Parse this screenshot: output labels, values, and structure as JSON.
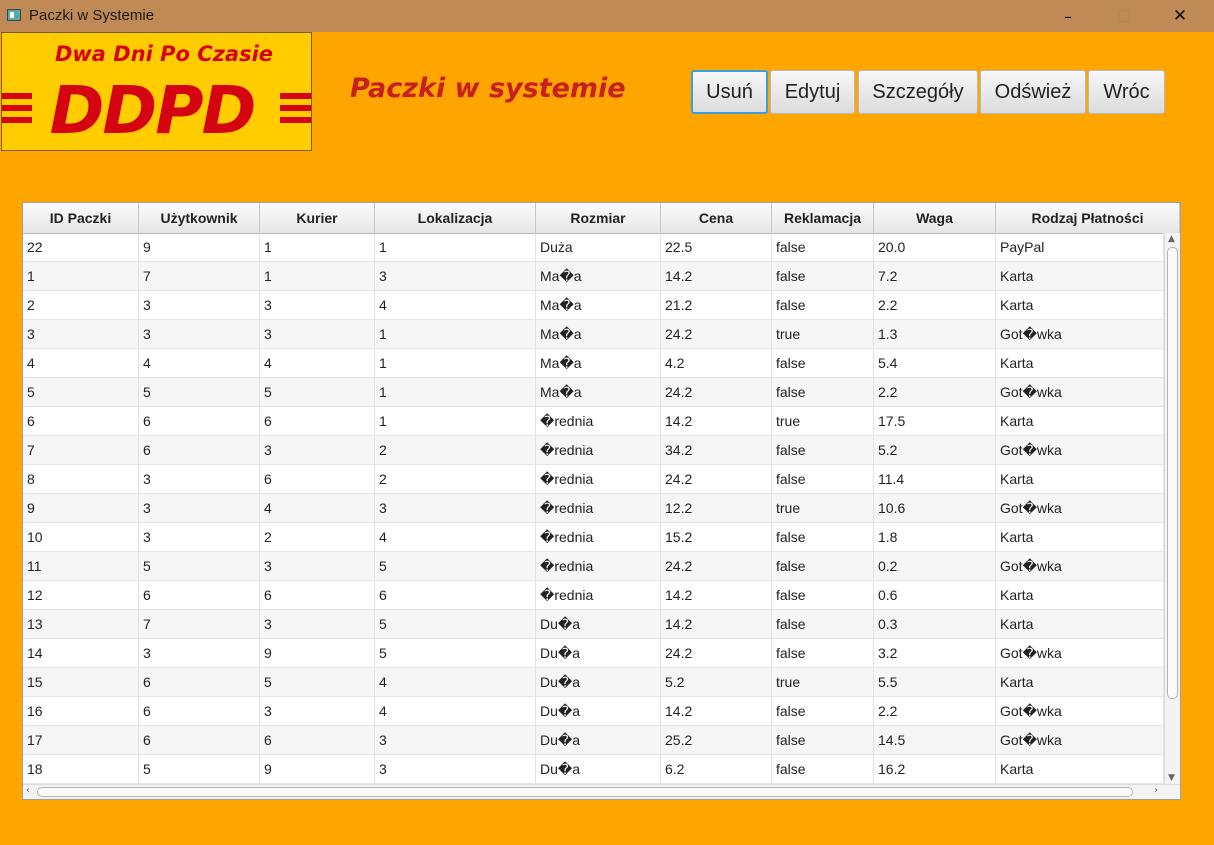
{
  "window": {
    "title": "Paczki w Systemie",
    "minimize_icon": "minimize-icon",
    "maximize_icon": "maximize-icon",
    "close_icon": "close-icon"
  },
  "logo": {
    "tagline": "Dwa Dni Po Czasie",
    "letters": "DDPD"
  },
  "header": {
    "title": "Paczki w systemie"
  },
  "toolbar": {
    "delete_label": "Usuń",
    "edit_label": "Edytuj",
    "details_label": "Szczegóły",
    "refresh_label": "Odśwież",
    "back_label": "Wróc"
  },
  "table": {
    "columns": [
      "ID Paczki",
      "Użytkownik",
      "Kurier",
      "Lokalizacja",
      "Rozmiar",
      "Cena",
      "Reklamacja",
      "Waga",
      "Rodzaj Płatności"
    ],
    "rows": [
      [
        "22",
        "9",
        "1",
        "1",
        "Duża",
        "22.5",
        "false",
        "20.0",
        "PayPal"
      ],
      [
        "1",
        "7",
        "1",
        "3",
        "Ma�a",
        "14.2",
        "false",
        "7.2",
        "Karta"
      ],
      [
        "2",
        "3",
        "3",
        "4",
        "Ma�a",
        "21.2",
        "false",
        "2.2",
        "Karta"
      ],
      [
        "3",
        "3",
        "3",
        "1",
        "Ma�a",
        "24.2",
        "true",
        "1.3",
        "Got�wka"
      ],
      [
        "4",
        "4",
        "4",
        "1",
        "Ma�a",
        "4.2",
        "false",
        "5.4",
        "Karta"
      ],
      [
        "5",
        "5",
        "5",
        "1",
        "Ma�a",
        "24.2",
        "false",
        "2.2",
        "Got�wka"
      ],
      [
        "6",
        "6",
        "6",
        "1",
        "�rednia",
        "14.2",
        "true",
        "17.5",
        "Karta"
      ],
      [
        "7",
        "6",
        "3",
        "2",
        "�rednia",
        "34.2",
        "false",
        "5.2",
        "Got�wka"
      ],
      [
        "8",
        "3",
        "6",
        "2",
        "�rednia",
        "24.2",
        "false",
        "11.4",
        "Karta"
      ],
      [
        "9",
        "3",
        "4",
        "3",
        "�rednia",
        "12.2",
        "true",
        "10.6",
        "Got�wka"
      ],
      [
        "10",
        "3",
        "2",
        "4",
        "�rednia",
        "15.2",
        "false",
        "1.8",
        "Karta"
      ],
      [
        "11",
        "5",
        "3",
        "5",
        "�rednia",
        "24.2",
        "false",
        "0.2",
        "Got�wka"
      ],
      [
        "12",
        "6",
        "6",
        "6",
        "�rednia",
        "14.2",
        "false",
        "0.6",
        "Karta"
      ],
      [
        "13",
        "7",
        "3",
        "5",
        "Du�a",
        "14.2",
        "false",
        "0.3",
        "Karta"
      ],
      [
        "14",
        "3",
        "9",
        "5",
        "Du�a",
        "24.2",
        "false",
        "3.2",
        "Got�wka"
      ],
      [
        "15",
        "6",
        "5",
        "4",
        "Du�a",
        "5.2",
        "true",
        "5.5",
        "Karta"
      ],
      [
        "16",
        "6",
        "3",
        "4",
        "Du�a",
        "14.2",
        "false",
        "2.2",
        "Got�wka"
      ],
      [
        "17",
        "6",
        "6",
        "3",
        "Du�a",
        "25.2",
        "false",
        "14.5",
        "Got�wka"
      ],
      [
        "18",
        "5",
        "9",
        "3",
        "Du�a",
        "6.2",
        "false",
        "16.2",
        "Karta"
      ]
    ]
  },
  "colors": {
    "background": "#ffa500",
    "titlebar": "#c08a56",
    "heading": "#c62020",
    "logo_bg": "#ffcc00",
    "logo_red": "#d40511"
  }
}
